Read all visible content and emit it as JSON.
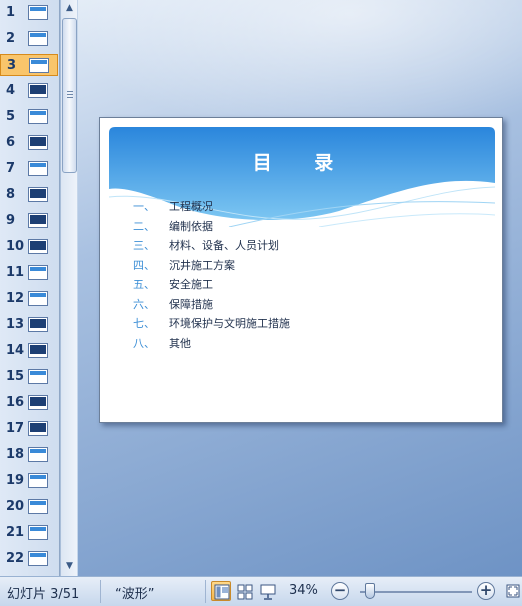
{
  "thumbnails": {
    "items": [
      {
        "number": "1",
        "dark": false
      },
      {
        "number": "2",
        "dark": false
      },
      {
        "number": "3",
        "dark": false,
        "selected": true
      },
      {
        "number": "4",
        "dark": true
      },
      {
        "number": "5",
        "dark": false
      },
      {
        "number": "6",
        "dark": true
      },
      {
        "number": "7",
        "dark": false
      },
      {
        "number": "8",
        "dark": true
      },
      {
        "number": "9",
        "dark": true
      },
      {
        "number": "10",
        "dark": true
      },
      {
        "number": "11",
        "dark": false
      },
      {
        "number": "12",
        "dark": false
      },
      {
        "number": "13",
        "dark": true
      },
      {
        "number": "14",
        "dark": true
      },
      {
        "number": "15",
        "dark": false
      },
      {
        "number": "16",
        "dark": true
      },
      {
        "number": "17",
        "dark": true
      },
      {
        "number": "18",
        "dark": false
      },
      {
        "number": "19",
        "dark": false
      },
      {
        "number": "20",
        "dark": false
      },
      {
        "number": "21",
        "dark": false
      },
      {
        "number": "22",
        "dark": false
      }
    ]
  },
  "slide": {
    "title": "目 录",
    "toc": [
      {
        "num": "一、",
        "text": "工程概况"
      },
      {
        "num": "二、",
        "text": "编制依据"
      },
      {
        "num": "三、",
        "text": "材料、设备、人员计划"
      },
      {
        "num": "四、",
        "text": "沉井施工方案"
      },
      {
        "num": "五、",
        "text": "安全施工"
      },
      {
        "num": "六、",
        "text": "保障措施"
      },
      {
        "num": "七、",
        "text": "环境保护与文明施工措施"
      },
      {
        "num": "八、",
        "text": "其他"
      }
    ]
  },
  "statusbar": {
    "slide_indicator": "幻灯片 3/51",
    "theme": "“波形”",
    "zoom": "34%"
  },
  "icons": {
    "scroll_up": "scroll-up-icon",
    "scroll_down": "scroll-down-icon",
    "normal_view": "normal-view-icon",
    "slide_sorter": "slide-sorter-icon",
    "slideshow": "slideshow-icon",
    "zoom_out": "zoom-out-icon",
    "zoom_in": "zoom-in-icon",
    "fit_window": "fit-window-icon"
  },
  "colors": {
    "selected_thumb": "#f9c56b",
    "toc_number": "#3d8fd6",
    "banner_blue": "#2f8ddf"
  }
}
